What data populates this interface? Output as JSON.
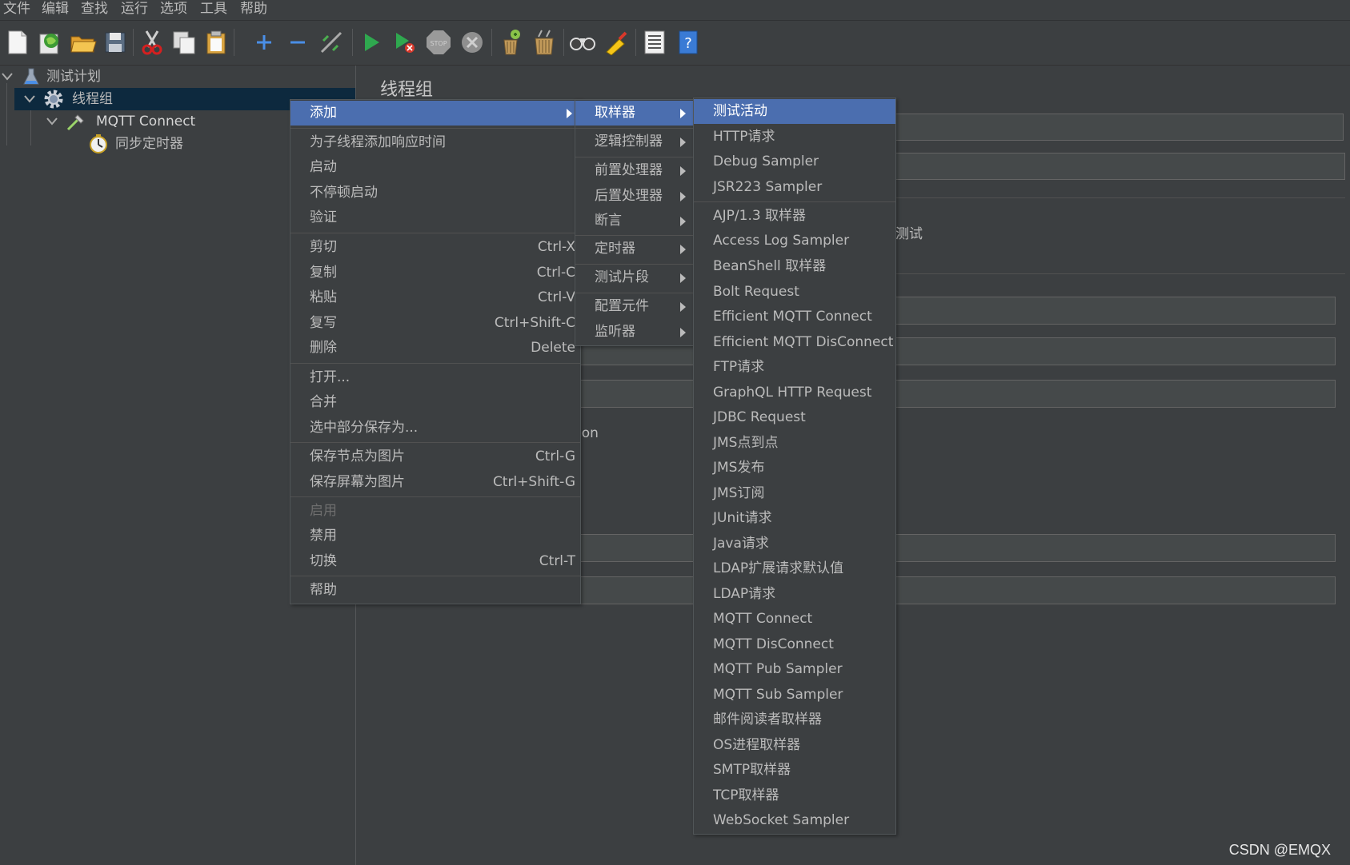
{
  "menubar": {
    "items": [
      "文件",
      "编辑",
      "查找",
      "运行",
      "选项",
      "工具",
      "帮助"
    ]
  },
  "toolbar": {
    "icons": [
      "new-icon",
      "templates-icon",
      "open-icon",
      "save-icon",
      "cut-icon",
      "copy-icon",
      "paste-icon",
      "expand-icon",
      "collapse-icon",
      "toggle-icon",
      "start-icon",
      "start-no-pause-icon",
      "stop-icon",
      "shutdown-icon",
      "clear-icon",
      "clear-all-icon",
      "search-icon",
      "reset-search-icon",
      "function-helper-icon",
      "help-icon"
    ]
  },
  "tree": {
    "test_plan": "测试计划",
    "thread_group": "线程组",
    "mqtt_connect": "MQTT Connect",
    "sync_timer": "同步定时器"
  },
  "right_panel": {
    "title": "线程组",
    "partial_label_1": "测试",
    "partial_label_2": "ion"
  },
  "context_menu": {
    "add": "添加",
    "add_think_times": "为子线程添加响应时间",
    "start": "启动",
    "start_no_pause": "不停顿启动",
    "validate": "验证",
    "cut": "剪切",
    "cut_sc": "Ctrl-X",
    "copy": "复制",
    "copy_sc": "Ctrl-C",
    "paste": "粘贴",
    "paste_sc": "Ctrl-V",
    "duplicate": "复写",
    "duplicate_sc": "Ctrl+Shift-C",
    "remove": "删除",
    "remove_sc": "Delete",
    "open": "打开...",
    "merge": "合并",
    "save_selection": "选中部分保存为...",
    "save_node_image": "保存节点为图片",
    "save_node_image_sc": "Ctrl-G",
    "save_screen_image": "保存屏幕为图片",
    "save_screen_image_sc": "Ctrl+Shift-G",
    "enable": "启用",
    "disable": "禁用",
    "toggle": "切换",
    "toggle_sc": "Ctrl-T",
    "help": "帮助"
  },
  "add_submenu": {
    "sampler": "取样器",
    "logic_controller": "逻辑控制器",
    "pre_processor": "前置处理器",
    "post_processor": "后置处理器",
    "assertion": "断言",
    "timer": "定时器",
    "test_fragment": "测试片段",
    "config_element": "配置元件",
    "listener": "监听器"
  },
  "sampler_submenu": [
    "测试活动",
    "HTTP请求",
    "Debug Sampler",
    "JSR223 Sampler",
    "AJP/1.3 取样器",
    "Access Log Sampler",
    "BeanShell 取样器",
    "Bolt Request",
    "Efficient MQTT Connect",
    "Efficient MQTT DisConnect",
    "FTP请求",
    "GraphQL HTTP Request",
    "JDBC Request",
    "JMS点到点",
    "JMS发布",
    "JMS订阅",
    "JUnit请求",
    "Java请求",
    "LDAP扩展请求默认值",
    "LDAP请求",
    "MQTT Connect",
    "MQTT DisConnect",
    "MQTT Pub Sampler",
    "MQTT Sub Sampler",
    "邮件阅读者取样器",
    "OS进程取样器",
    "SMTP取样器",
    "TCP取样器",
    "WebSocket Sampler"
  ],
  "watermark": "CSDN @EMQX"
}
